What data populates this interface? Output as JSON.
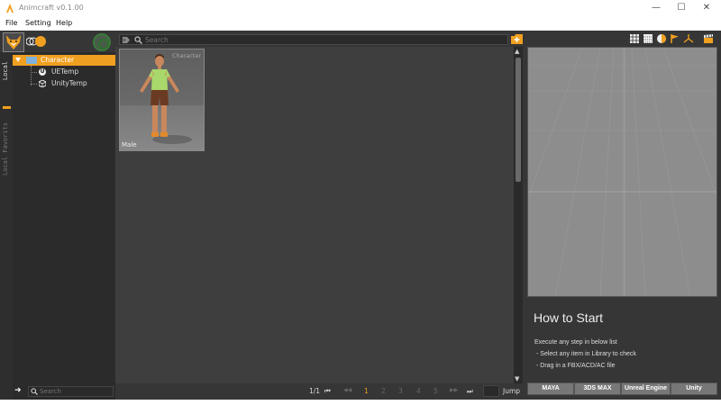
{
  "window": {
    "title": "Animcraft v0.1.00",
    "minimize": "—",
    "maximize": "☐",
    "close": "✕"
  },
  "menu": [
    "File",
    "Setting",
    "Help"
  ],
  "left_tabs": [
    "Local",
    "Local Favorits"
  ],
  "tree": {
    "items": [
      {
        "label": "Character",
        "selected": true
      },
      {
        "label": "UETemp",
        "selected": false
      },
      {
        "label": "UnityTemp",
        "selected": false
      }
    ]
  },
  "left_search": {
    "placeholder": "Search"
  },
  "main_search": {
    "placeholder": "Search"
  },
  "cards": [
    {
      "name": "Male",
      "category": "Character"
    }
  ],
  "pager": {
    "page_info": "1/1",
    "first": "⏮",
    "prev": "◀◀",
    "pages": [
      "1",
      "2",
      "3",
      "4",
      "5"
    ],
    "current_page": "1",
    "next": "▶▶",
    "last": "⏭",
    "jump_label": "Jump"
  },
  "right_panel": {
    "how_title": "How to Start",
    "lines": [
      "Execute any step in below list",
      "- Select any item in Library to check",
      "- Drag in a FBX/ACD/AC file"
    ],
    "export_buttons": [
      "MAYA",
      "3DS MAX",
      "Unreal Engine",
      "Unity"
    ]
  },
  "colors": {
    "accent": "#f0a020",
    "panel_dark": "#2b2b2b",
    "content_bg": "#3e3e3e",
    "viewport_bg": "#8c8c8c"
  },
  "icons": [
    "app-logo-icon",
    "fox-logo-icon",
    "toggle-icon",
    "sync-icon",
    "tag-icon",
    "search-icon",
    "folder-add-icon",
    "grid-icon",
    "texture-icon",
    "light-icon",
    "flag-icon",
    "axis-icon",
    "clapper-icon",
    "unreal-icon",
    "unity-icon",
    "folder-icon",
    "arrow-right-icon"
  ]
}
